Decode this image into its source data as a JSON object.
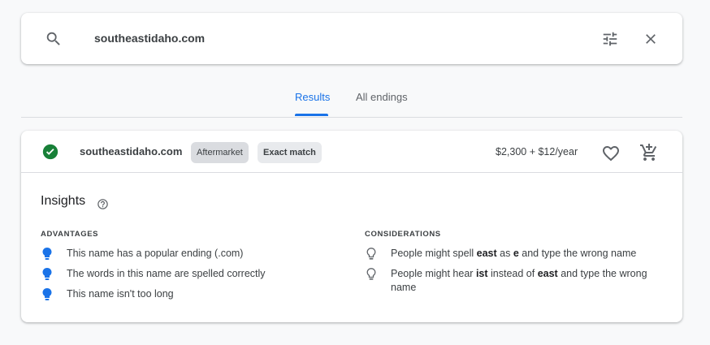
{
  "search": {
    "query": "southeastidaho.com"
  },
  "tabs": [
    {
      "label": "Results",
      "active": true
    },
    {
      "label": "All endings",
      "active": false
    }
  ],
  "result": {
    "domain": "southeastidaho.com",
    "status": "available",
    "chips": [
      "Aftermarket",
      "Exact match"
    ],
    "price": "$2,300 + $12/year"
  },
  "insights": {
    "title": "Insights",
    "advantages_label": "ADVANTAGES",
    "advantages": [
      "This name has a popular ending (.com)",
      "The words in this name are spelled correctly",
      "This name isn't too long"
    ],
    "considerations_label": "CONSIDERATIONS",
    "considerations": [
      {
        "pre": "People might spell ",
        "b1": "east",
        "mid": " as ",
        "b2": "e",
        "post": " and type the wrong name"
      },
      {
        "pre": "People might hear ",
        "b1": "ist",
        "mid": " instead of ",
        "b2": "east",
        "post": " and type the wrong name"
      }
    ]
  },
  "colors": {
    "accent": "#1a73e8",
    "success": "#188038",
    "bulb_filled": "#1a73e8"
  },
  "icons": [
    "search-icon",
    "tune-icon",
    "close-icon",
    "check-circle-icon",
    "heart-icon",
    "add-cart-icon",
    "help-icon",
    "lightbulb-filled-icon",
    "lightbulb-outline-icon"
  ]
}
